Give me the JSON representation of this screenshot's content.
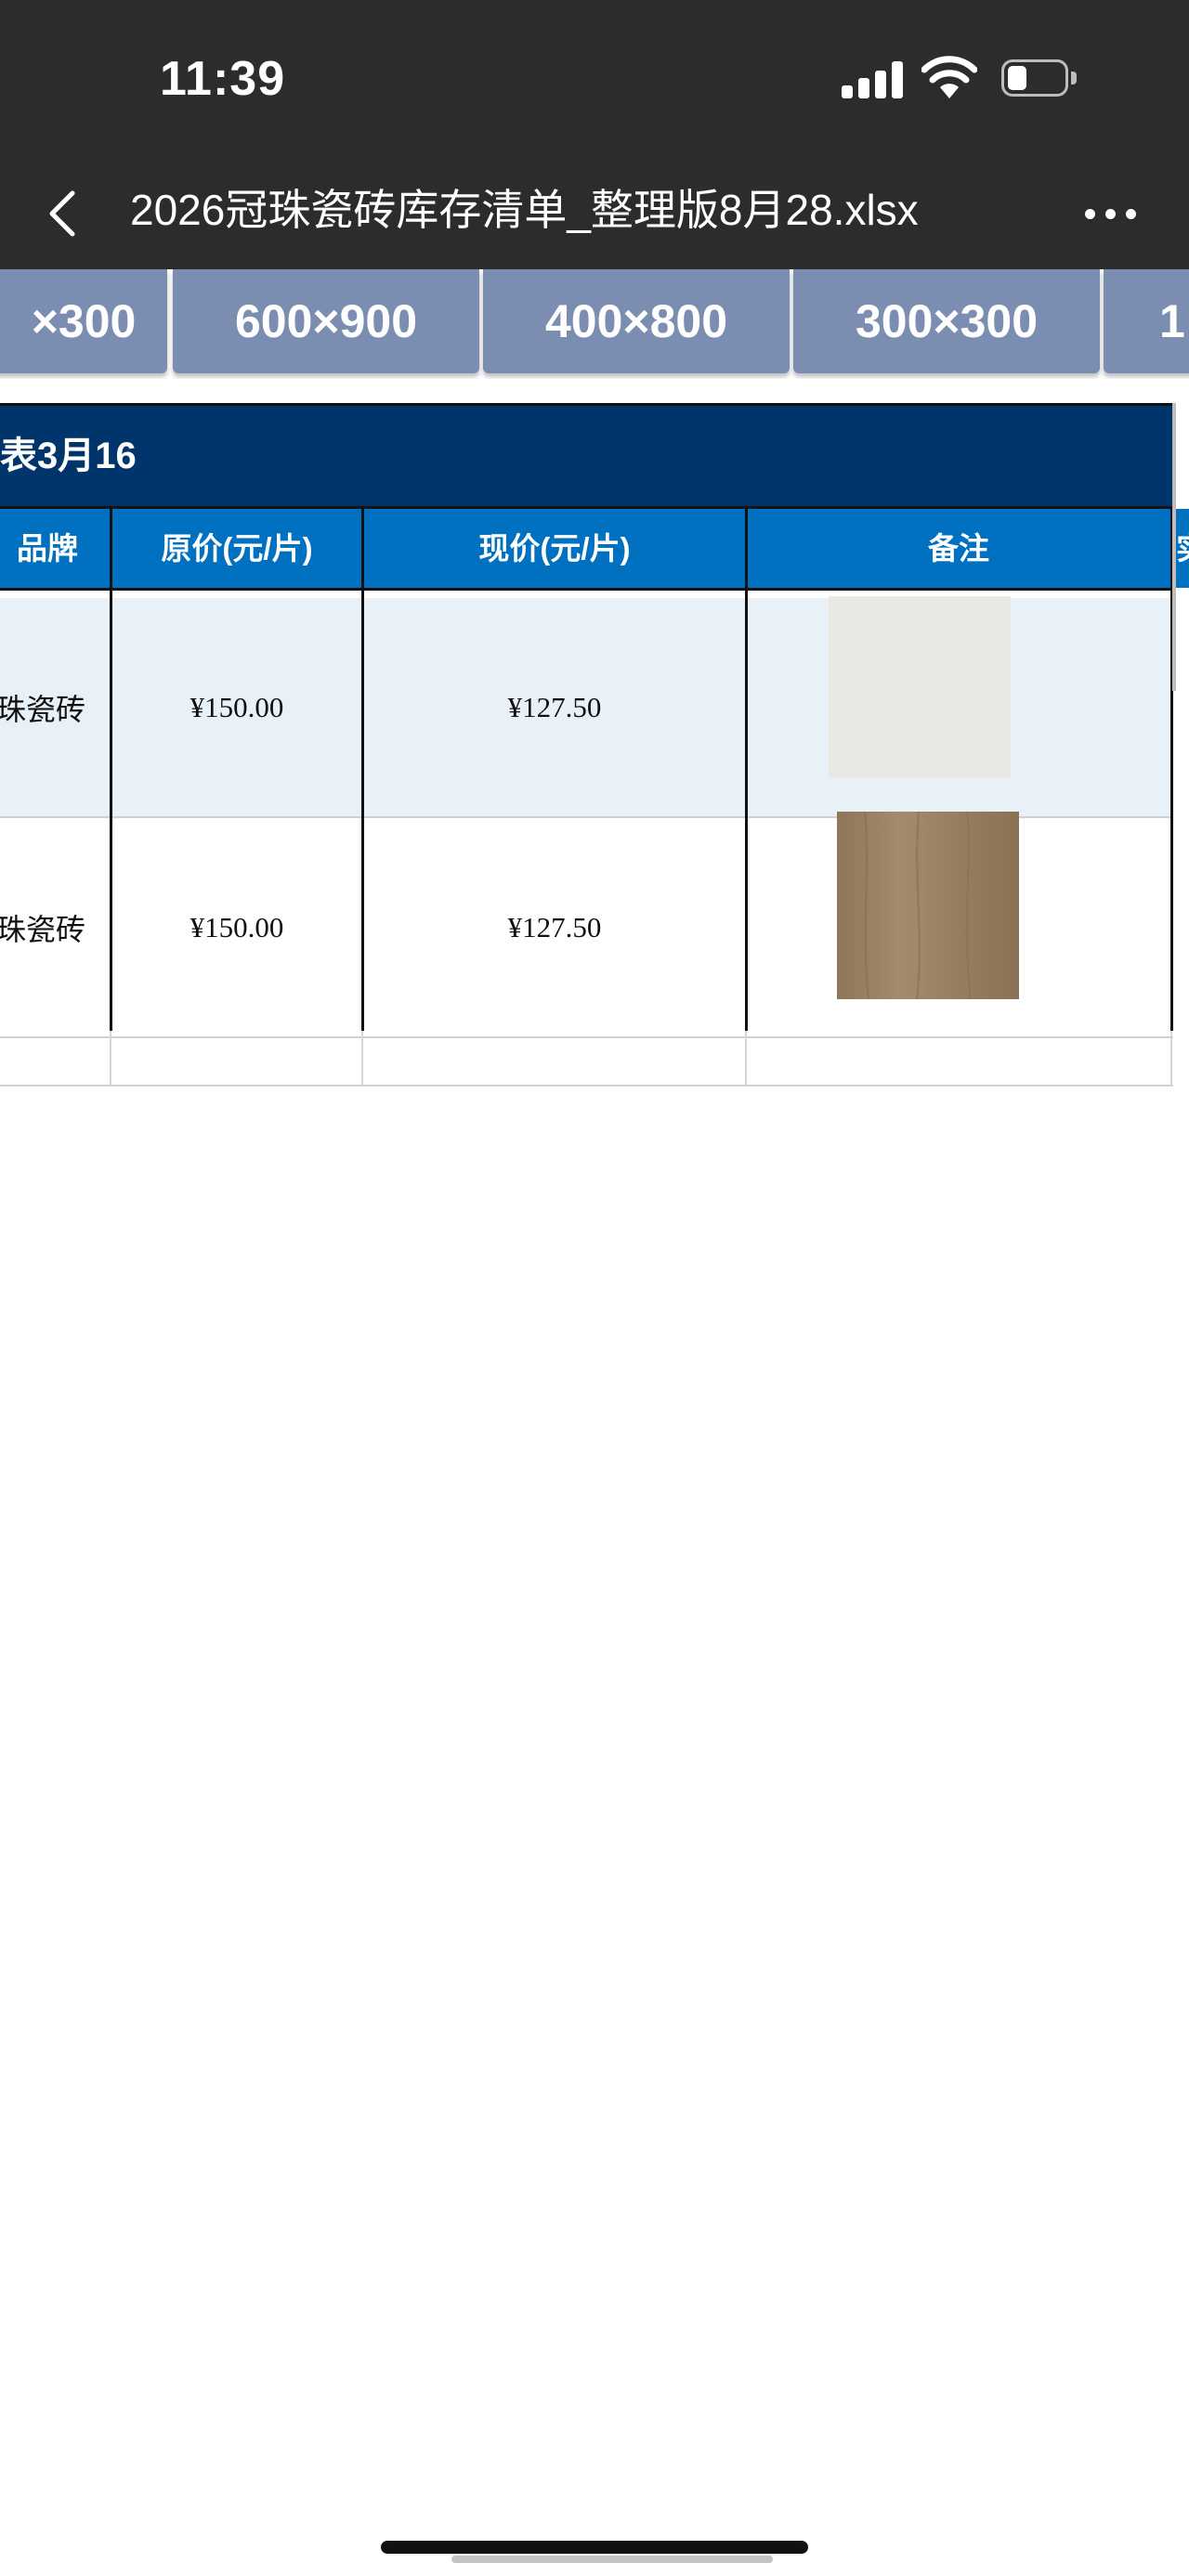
{
  "status_bar": {
    "time": "11:39"
  },
  "nav": {
    "title": "2026冠珠瓷砖库存清单_整理版8月28.xlsx"
  },
  "sheet_tabs": [
    "×300",
    "600×900",
    "400×800",
    "300×300",
    "1"
  ],
  "sheet": {
    "title": "表3月16",
    "headers": {
      "brand": "品牌",
      "original_price": "原价(元/片)",
      "current_price": "现价(元/片)",
      "remark": "备注",
      "next": "实"
    },
    "rows": [
      {
        "brand": "珠瓷砖",
        "original_price": "¥150.00",
        "current_price": "¥127.50",
        "tile_color": "#e9e8e3"
      },
      {
        "brand": "珠瓷砖",
        "original_price": "¥150.00",
        "current_price": "¥127.50",
        "tile_color": "#9a8266"
      }
    ]
  },
  "colors": {
    "title_row": "#00356b",
    "header_row": "#0070c0",
    "row_alt": "#e8f0f8",
    "tab": "#7b8db0"
  }
}
